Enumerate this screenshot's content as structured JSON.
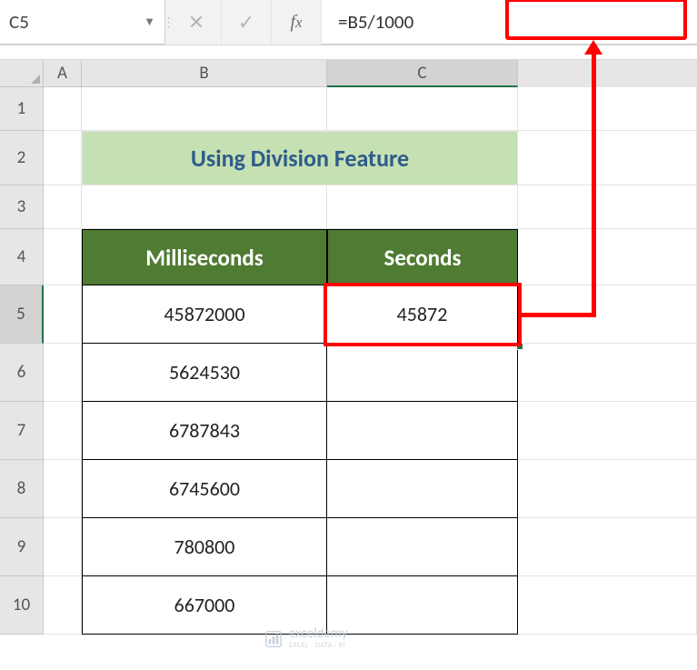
{
  "namebox": "C5",
  "formula": "=B5/1000",
  "columns": {
    "A": "A",
    "B": "B",
    "C": "C"
  },
  "row_labels": [
    "1",
    "2",
    "3",
    "4",
    "5",
    "6",
    "7",
    "8",
    "9",
    "10"
  ],
  "title": "Using Division Feature",
  "headers": {
    "ms": "Milliseconds",
    "sec": "Seconds"
  },
  "table": [
    {
      "ms": "45872000",
      "sec": "45872"
    },
    {
      "ms": "5624530",
      "sec": ""
    },
    {
      "ms": "6787843",
      "sec": ""
    },
    {
      "ms": "6745600",
      "sec": ""
    },
    {
      "ms": "780800",
      "sec": ""
    },
    {
      "ms": "667000",
      "sec": ""
    }
  ],
  "watermark": {
    "brand": "exceldemy",
    "tag": "EXCEL · DATA · BI"
  },
  "chart_data": {
    "type": "table",
    "title": "Using Division Feature",
    "columns": [
      "Milliseconds",
      "Seconds"
    ],
    "rows": [
      [
        45872000,
        45872
      ],
      [
        5624530,
        null
      ],
      [
        6787843,
        null
      ],
      [
        6745600,
        null
      ],
      [
        780800,
        null
      ],
      [
        667000,
        null
      ]
    ],
    "formula": "=B5/1000"
  }
}
